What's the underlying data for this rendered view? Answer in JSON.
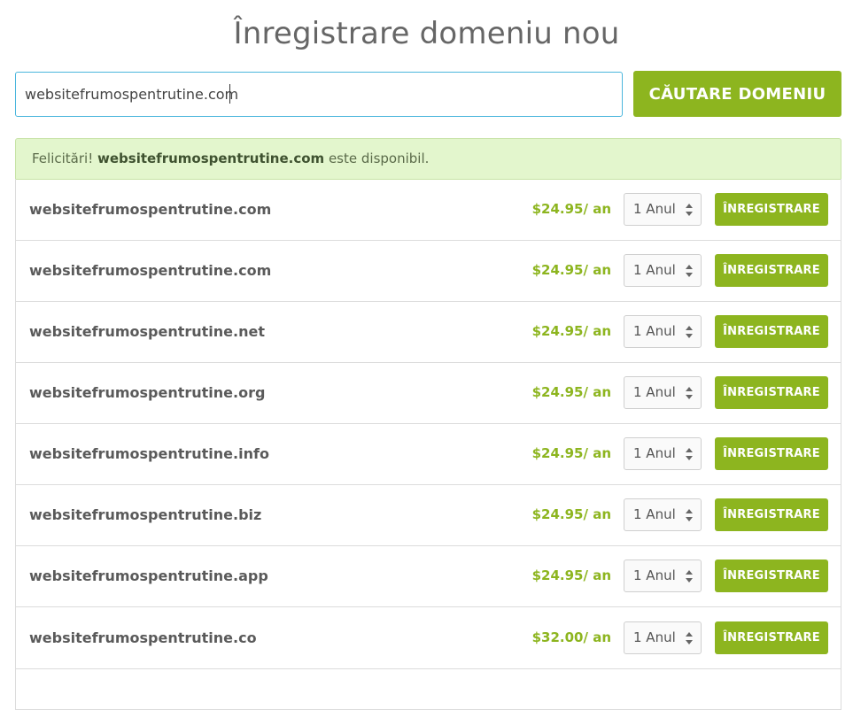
{
  "header": {
    "title": "Înregistrare domeniu nou"
  },
  "search": {
    "value": "websitefrumospentrutine.com",
    "button_label": "CĂUTARE DOMENIU"
  },
  "alert": {
    "prefix": "Felicitări!",
    "domain": "websitefrumospentrutine.com",
    "suffix": "este disponibil."
  },
  "results": [
    {
      "domain": "websitefrumospentrutine.com",
      "price": "$24.95/ an",
      "period": "1 Anul",
      "button": "ÎNREGISTRARE"
    },
    {
      "domain": "websitefrumospentrutine.com",
      "price": "$24.95/ an",
      "period": "1 Anul",
      "button": "ÎNREGISTRARE"
    },
    {
      "domain": "websitefrumospentrutine.net",
      "price": "$24.95/ an",
      "period": "1 Anul",
      "button": "ÎNREGISTRARE"
    },
    {
      "domain": "websitefrumospentrutine.org",
      "price": "$24.95/ an",
      "period": "1 Anul",
      "button": "ÎNREGISTRARE"
    },
    {
      "domain": "websitefrumospentrutine.info",
      "price": "$24.95/ an",
      "period": "1 Anul",
      "button": "ÎNREGISTRARE"
    },
    {
      "domain": "websitefrumospentrutine.biz",
      "price": "$24.95/ an",
      "period": "1 Anul",
      "button": "ÎNREGISTRARE"
    },
    {
      "domain": "websitefrumospentrutine.app",
      "price": "$24.95/ an",
      "period": "1 Anul",
      "button": "ÎNREGISTRARE"
    },
    {
      "domain": "websitefrumospentrutine.co",
      "price": "$32.00/ an",
      "period": "1 Anul",
      "button": "ÎNREGISTRARE"
    }
  ],
  "colors": {
    "accent": "#8db51f",
    "alert_bg": "#e3f6cd",
    "input_border": "#4bb6dd"
  },
  "icons": {
    "select_arrows": "sort-arrows-icon"
  }
}
